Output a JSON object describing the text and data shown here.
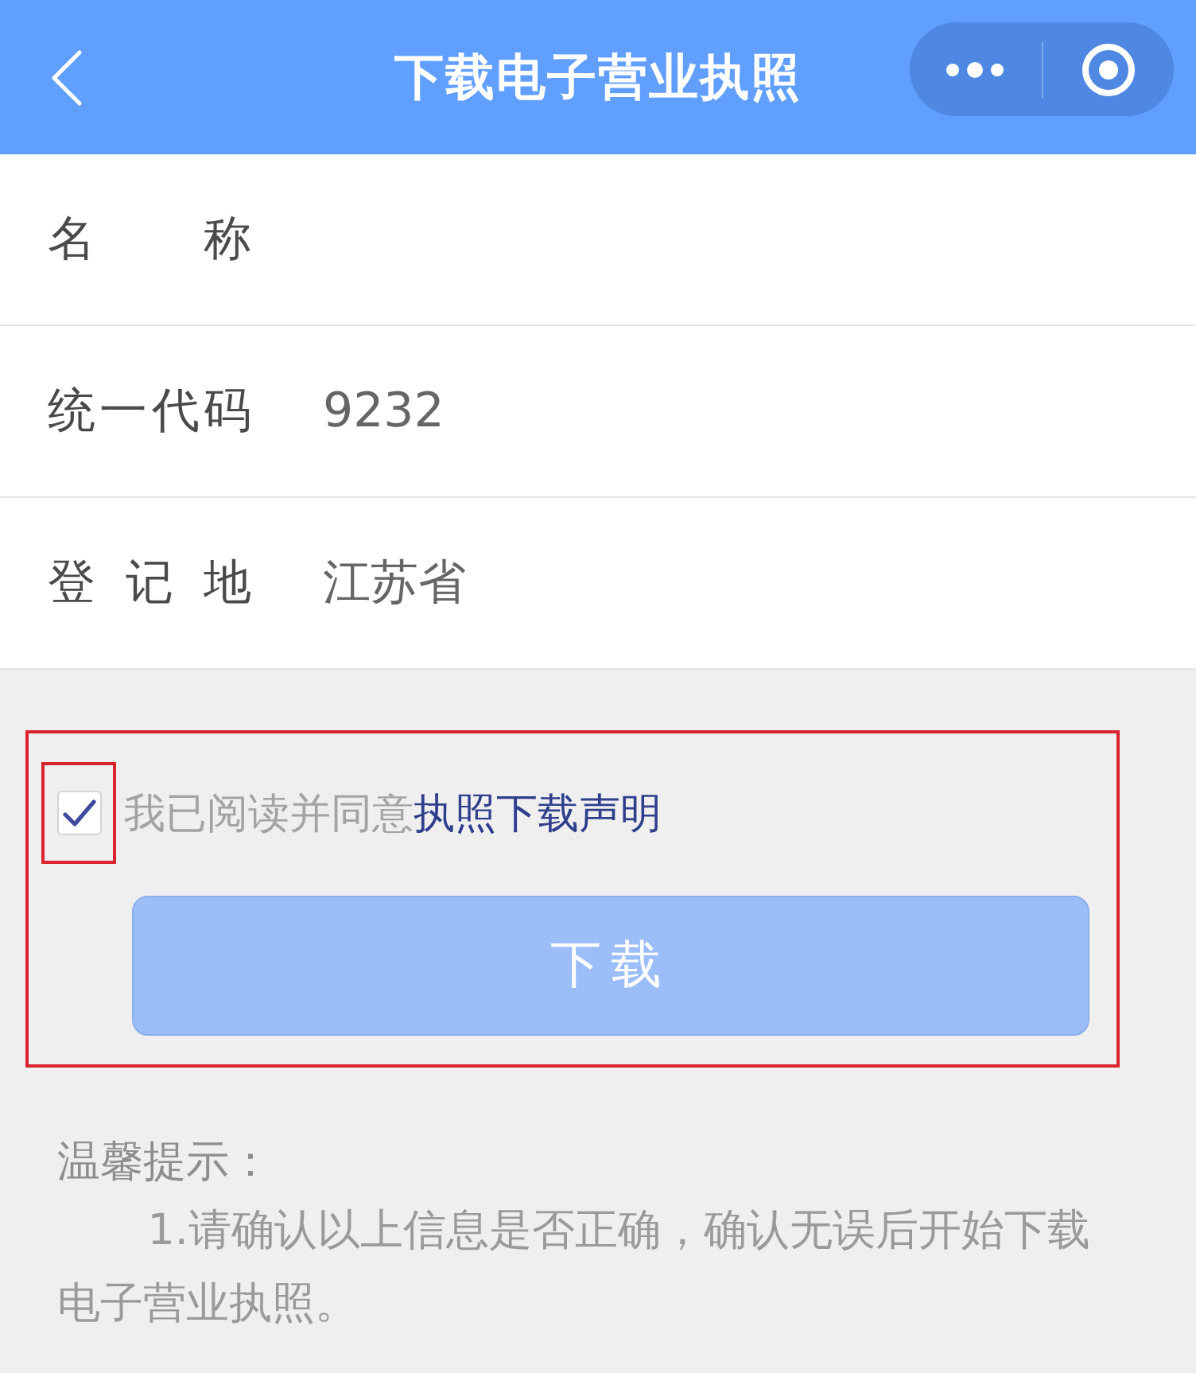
{
  "nav_bar": {
    "title": "下载电子营业执照"
  },
  "fields": [
    {
      "label": "名 称"
    },
    {
      "label": "统一代码",
      "value": "9232"
    },
    {
      "label": "登 记 地",
      "value": "江苏省"
    }
  ],
  "agreement": {
    "highlighted": true,
    "checkbox": {
      "checked": true,
      "highlighted": true
    },
    "text": "我已阅读并同意",
    "link": "执照下载声明"
  },
  "download_button": {
    "label": "下载"
  },
  "tips": {
    "heading": "温馨提示：",
    "items": [
      "1.请确认以上信息是否正确，确认无误后开始下载电子营业执照。"
    ]
  }
}
